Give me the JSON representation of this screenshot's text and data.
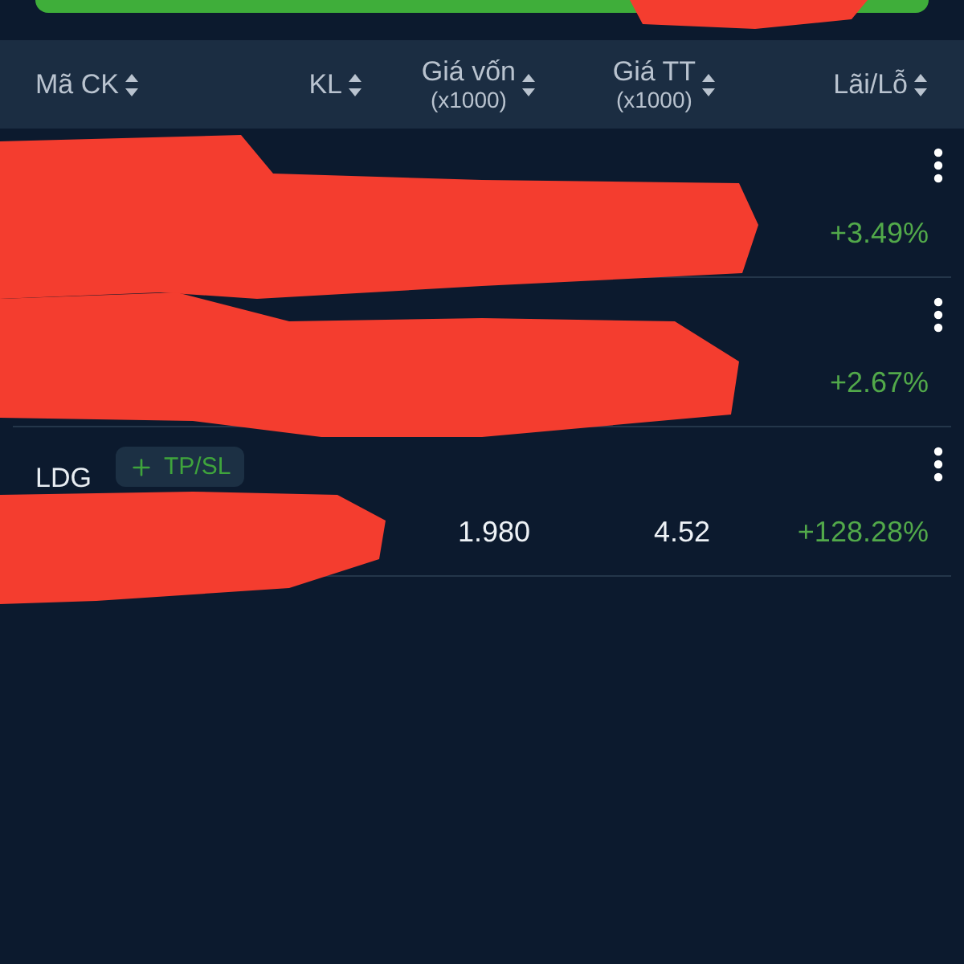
{
  "columns": [
    {
      "label": "Mã CK"
    },
    {
      "label": "KL"
    },
    {
      "label": "Giá vốn",
      "sub": "(x1000)"
    },
    {
      "label": "Giá TT",
      "sub": "(x1000)"
    },
    {
      "label": "Lãi/Lỗ"
    }
  ],
  "rows": [
    {
      "pnl": "+3.49%"
    },
    {
      "pnl": "+2.67%"
    },
    {
      "code": "LDG",
      "badge": "TP/SL",
      "cost": "1.980",
      "price": "4.52",
      "pnl": "+128.28%"
    }
  ]
}
